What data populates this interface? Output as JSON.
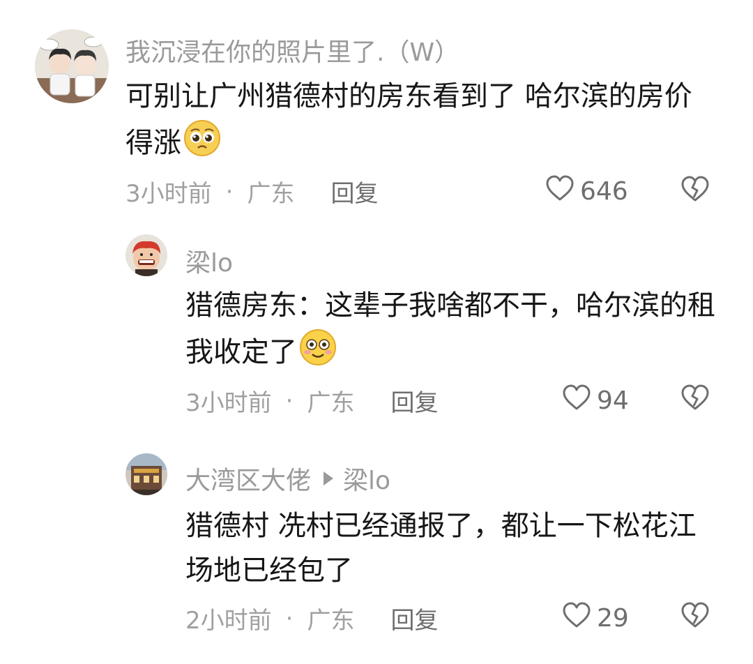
{
  "comments": [
    {
      "username": "我沉浸在你的照片里了.（W）",
      "text": "可别让广州猎德村的房东看到了 哈尔滨的房价得涨",
      "emoji": "pleading-face-emoji",
      "time": "3小时前",
      "separator": "·",
      "location": "广东",
      "reply_label": "回复",
      "likes": "646",
      "avatar": "cartoon-couple-avatar"
    },
    {
      "username": "梁lo",
      "text": "猎德房东：这辈子我啥都不干，哈尔滨的租我收定了",
      "emoji": "flushed-smile-emoji",
      "time": "3小时前",
      "separator": "·",
      "location": "广东",
      "reply_label": "回复",
      "likes": "94",
      "avatar": "red-hair-cartoon-avatar"
    },
    {
      "username": "大湾区大佬",
      "reply_to": "梁lo",
      "text": "猎德村 冼村已经通报了，都让一下松花江场地已经包了",
      "time": "2小时前",
      "separator": "·",
      "location": "广东",
      "reply_label": "回复",
      "likes": "29",
      "avatar": "building-photo-avatar"
    }
  ],
  "icons": {
    "like": "heart-outline-icon",
    "dislike": "broken-heart-icon"
  },
  "colors": {
    "username": "#9a9a9a",
    "text": "#161616",
    "meta": "#a0a0a0",
    "action": "#6e6e6e"
  }
}
